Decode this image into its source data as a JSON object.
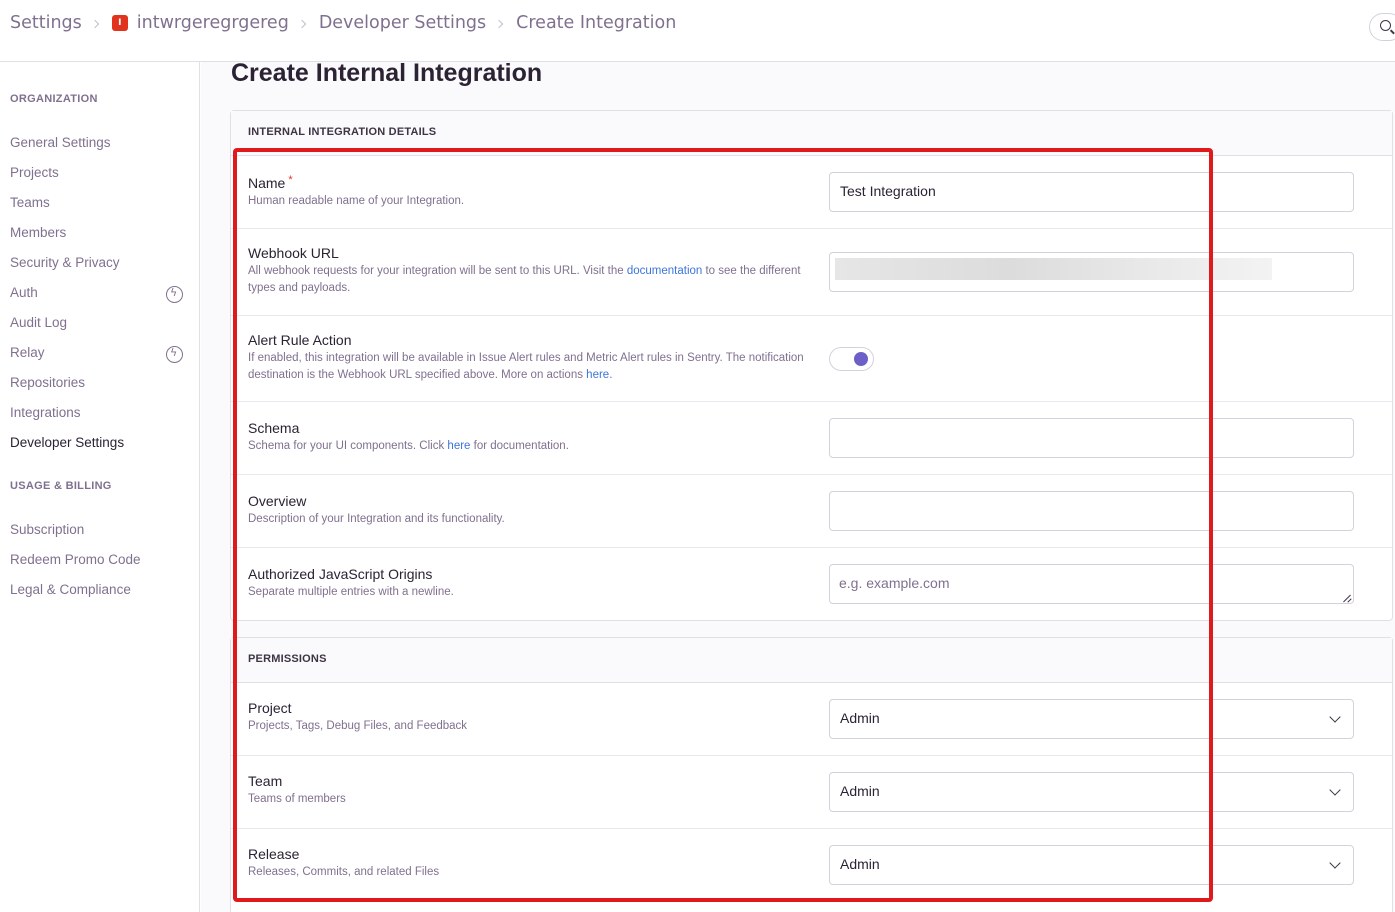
{
  "breadcrumb": {
    "items": [
      "Settings",
      "intwrgeregrgereg",
      "Developer Settings",
      "Create Integration"
    ],
    "org_badge": "I"
  },
  "sidebar": {
    "org_heading": "ORGANIZATION",
    "org_items": [
      {
        "label": "General Settings"
      },
      {
        "label": "Projects"
      },
      {
        "label": "Teams"
      },
      {
        "label": "Members"
      },
      {
        "label": "Security & Privacy"
      },
      {
        "label": "Auth",
        "icon": "bolt-icon"
      },
      {
        "label": "Audit Log"
      },
      {
        "label": "Relay",
        "icon": "bolt-icon"
      },
      {
        "label": "Repositories"
      },
      {
        "label": "Integrations"
      },
      {
        "label": "Developer Settings",
        "active": true
      }
    ],
    "billing_heading": "USAGE & BILLING",
    "billing_items": [
      {
        "label": "Subscription"
      },
      {
        "label": "Redeem Promo Code"
      },
      {
        "label": "Legal & Compliance"
      }
    ]
  },
  "page": {
    "title": "Create Internal Integration"
  },
  "details": {
    "heading": "INTERNAL INTEGRATION DETAILS",
    "name": {
      "label": "Name",
      "required": "*",
      "help": "Human readable name of your Integration.",
      "value": "Test Integration"
    },
    "webhook": {
      "label": "Webhook URL",
      "help_before": "All webhook requests for your integration will be sent to this URL. Visit the ",
      "help_link": "documentation",
      "help_after": " to see the different types and payloads."
    },
    "alert": {
      "label": "Alert Rule Action",
      "help_before": "If enabled, this integration will be available in Issue Alert rules and Metric Alert rules in Sentry. The notification destination is the Webhook URL specified above. More on actions ",
      "help_link": "here",
      "help_after": ".",
      "enabled": true
    },
    "schema": {
      "label": "Schema",
      "help_before": "Schema for your UI components. Click ",
      "help_link": "here",
      "help_after": " for documentation.",
      "value": ""
    },
    "overview": {
      "label": "Overview",
      "help": "Description of your Integration and its functionality.",
      "value": ""
    },
    "origins": {
      "label": "Authorized JavaScript Origins",
      "help": "Separate multiple entries with a newline.",
      "placeholder": "e.g. example.com"
    }
  },
  "permissions": {
    "heading": "PERMISSIONS",
    "project": {
      "label": "Project",
      "help": "Projects, Tags, Debug Files, and Feedback",
      "value": "Admin"
    },
    "team": {
      "label": "Team",
      "help": "Teams of members",
      "value": "Admin"
    },
    "release": {
      "label": "Release",
      "help": "Releases, Commits, and related Files",
      "value": "Admin"
    }
  },
  "colors": {
    "accent": "#6c5fc7",
    "link": "#3d74db",
    "highlight": "#e0191c",
    "required": "#e1341e"
  }
}
